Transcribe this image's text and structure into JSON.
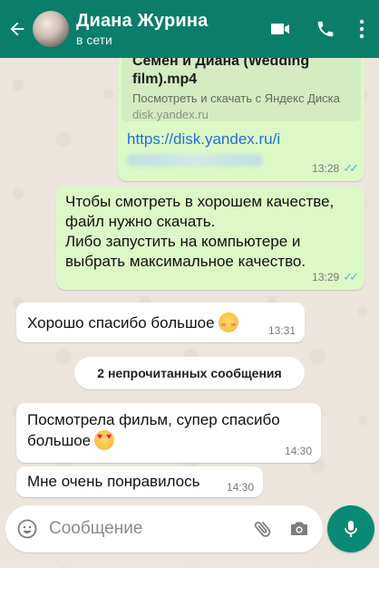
{
  "header": {
    "contact_name": "Диана Журина",
    "status": "в сети",
    "accent_color": "#0a7e6a"
  },
  "messages": [
    {
      "direction": "out",
      "preview_title": "Семен и Диана (Wedding film).mp4",
      "preview_desc": "Посмотреть и скачать с Яндекс Диска",
      "preview_domain": "disk.yandex.ru",
      "link": "https://disk.yandex.ru/i",
      "time": "13:28",
      "read": true
    },
    {
      "direction": "out",
      "text_lines": [
        "Чтобы смотреть в хорошем качестве,",
        "файл нужно скачать.",
        "Либо запустить на компьютере и",
        "выбрать максимальное качество."
      ],
      "time": "13:29",
      "read": true
    },
    {
      "direction": "in",
      "text": "Хорошо спасибо большое",
      "emoji": "smiling-face-with-blush",
      "time": "13:31"
    },
    {
      "direction": "in",
      "text_lines": [
        "Посмотрела фильм, супер спасибо",
        "большое"
      ],
      "emoji": "smiling-face-with-heart-eyes",
      "time": "14:30"
    },
    {
      "direction": "in",
      "text": "Мне очень понравилось",
      "time": "14:30"
    }
  ],
  "unread_divider": "2 непрочитанных сообщения",
  "composer": {
    "placeholder": "Сообщение"
  },
  "icons": {
    "back": "back-arrow-icon",
    "video": "video-call-icon",
    "phone": "phone-icon",
    "menu": "more-vert-icon",
    "emoji": "emoji-icon",
    "attach": "paperclip-icon",
    "camera": "camera-icon",
    "mic": "mic-icon"
  }
}
